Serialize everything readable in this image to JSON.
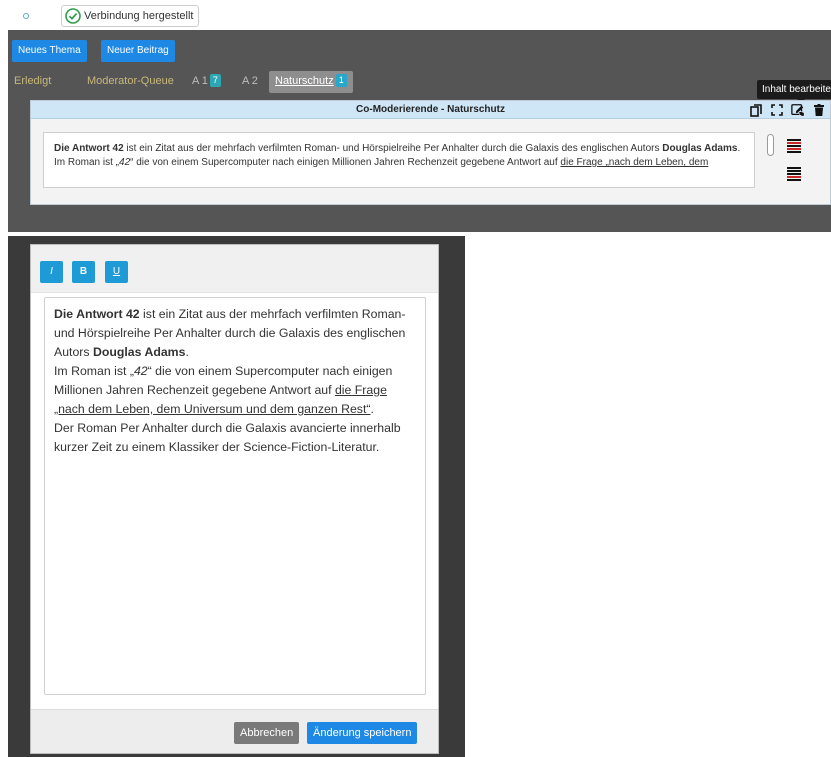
{
  "status": {
    "connection_label": "Verbindung hergestellt"
  },
  "toolbar": {
    "new_topic": "Neues Thema",
    "new_post": "Neuer Beitrag"
  },
  "tabs": [
    {
      "label": "Erledigt"
    },
    {
      "label": "Moderator-Queue"
    },
    {
      "label": "A 1",
      "badge": "7"
    },
    {
      "label": "A 2"
    },
    {
      "label": "Naturschutz",
      "badge": "1"
    }
  ],
  "tooltip": "Inhalt bearbeiten",
  "post": {
    "header": "Co-Moderierende - Naturschutz",
    "line1_bold": "Die Antwort 42",
    "line1_text": " ist ein Zitat aus der mehrfach verfilmten Roman- und Hörspielreihe Per Anhalter durch die Galaxis des englischen Autors ",
    "line1_author": "Douglas Adams",
    "line1_end": ".",
    "line2_text": "Im Roman ist „",
    "line2_italic": "42",
    "line2_text2": "“ die von einem Supercomputer nach einigen Millionen Jahren Rechenzeit gegebene Antwort auf ",
    "line2_link": "die Frage „nach dem Leben, dem"
  },
  "editor": {
    "buttons": {
      "italic": "I",
      "bold": "B",
      "underline": "U"
    },
    "p1_bold": "Die Antwort 42",
    "p1_text": " ist ein Zitat aus der mehrfach verfilmten Roman- und Hörspielreihe Per Anhalter durch die Galaxis des englischen Autors ",
    "p1_author": "Douglas Adams",
    "p1_end": ".",
    "p2_text": "Im Roman ist „",
    "p2_italic": "42",
    "p2_text2": "“ die von einem Supercomputer nach einigen Millionen Jahren Rechenzeit gegebene Antwort auf ",
    "p2_link": "die Frage „nach dem Leben, dem Universum und dem ganzen Rest“",
    "p2_end": ".",
    "p3_text": "Der Roman Per Anhalter durch die Galaxis avancierte innerhalb kurzer Zeit zu einem Klassiker der Science-Fiction-Literatur.",
    "cancel": "Abbrechen",
    "save": "Änderung speichern"
  },
  "colors": {
    "primary": "#1e88e5",
    "panel": "#555555",
    "header": "#cfe6f6",
    "success": "#2e9e4a"
  }
}
